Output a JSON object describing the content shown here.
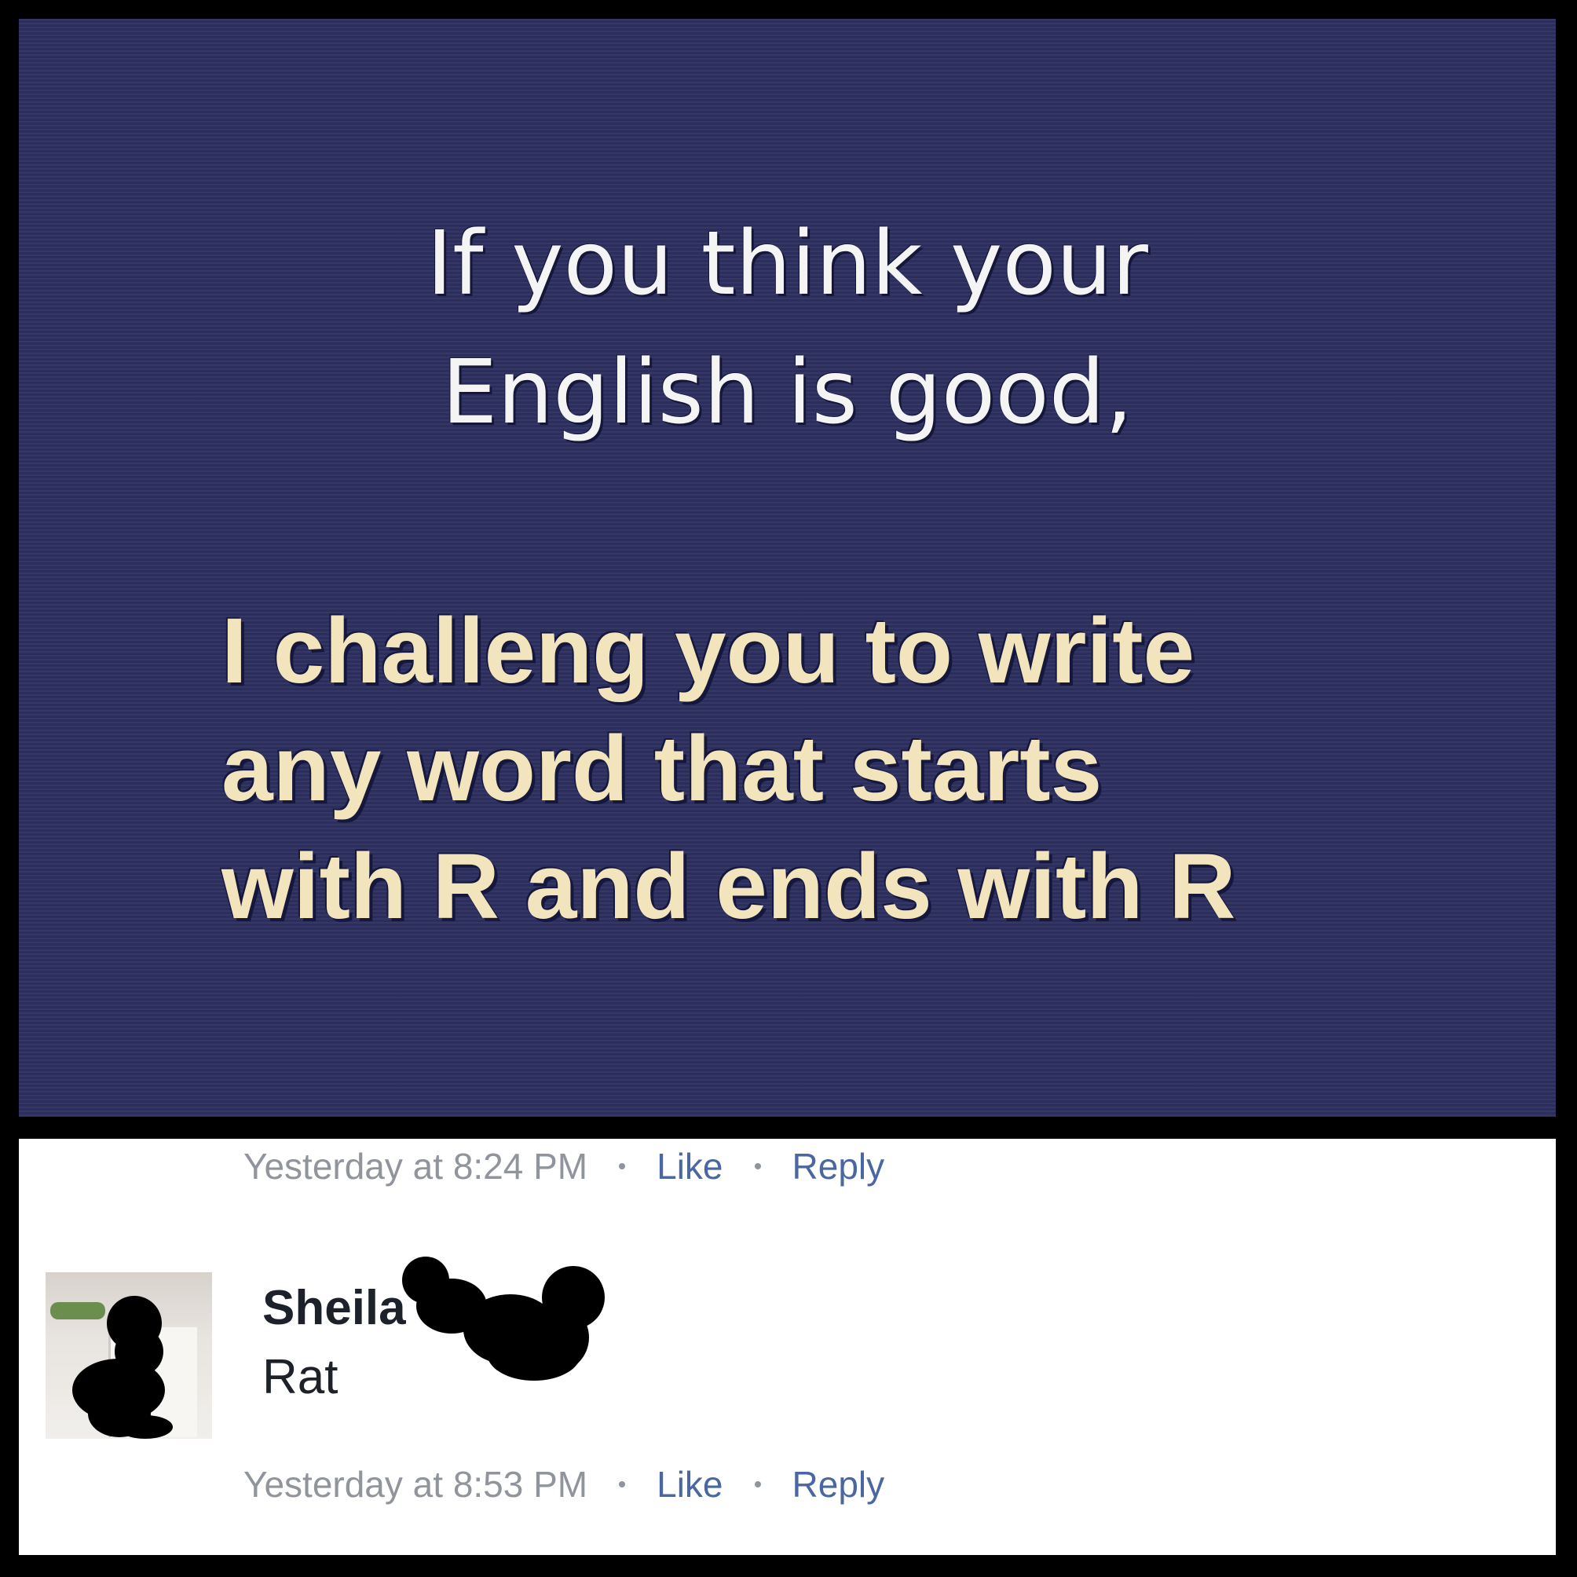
{
  "post_image": {
    "headline_white": [
      "If you think your",
      "English is good,"
    ],
    "headline_cream": [
      "I challeng you to write",
      "any word that starts",
      "with R and ends with R"
    ],
    "background_color": "#2e3161",
    "text_colors": {
      "white": "#f4f4f4",
      "cream": "#f2e4bd"
    }
  },
  "comments": [
    {
      "author": "",
      "text": "",
      "timestamp": "Yesterday at 8:24 PM",
      "like_label": "Like",
      "reply_label": "Reply"
    },
    {
      "author": "Sheila",
      "author_redacted": true,
      "avatar_redacted": true,
      "text": "Rat",
      "timestamp": "Yesterday at 8:53 PM",
      "like_label": "Like",
      "reply_label": "Reply"
    }
  ],
  "colors": {
    "link": "#4b67a1",
    "meta_text": "#90949c",
    "body_text": "#1d2129",
    "redaction": "#000000"
  }
}
